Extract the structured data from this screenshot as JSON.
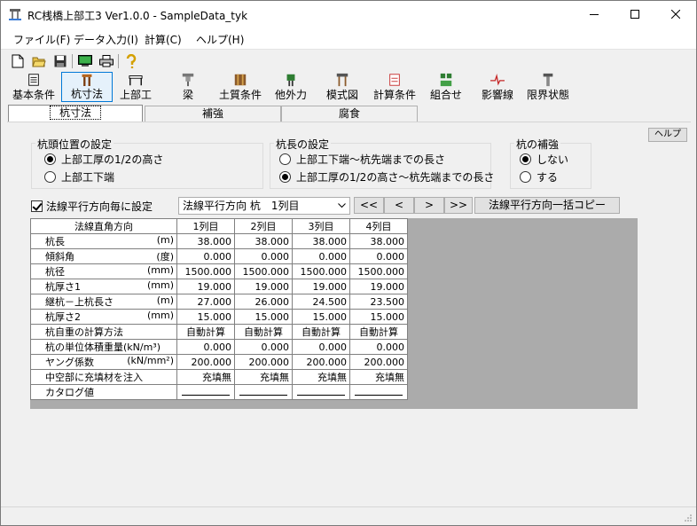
{
  "window": {
    "title": "RC桟橋上部工3 Ver1.0.0 - SampleData_tyk"
  },
  "menu": [
    "ファイル(F)",
    "データ入力(I)",
    "計算(C)",
    "ヘルプ(H)"
  ],
  "toolbar_small": [
    "new-file-icon",
    "open-folder-icon",
    "save-icon",
    "calc-icon",
    "print-icon",
    "help-icon"
  ],
  "toolbar_big": [
    {
      "label": "基本条件"
    },
    {
      "label": "杭寸法"
    },
    {
      "label": "上部工"
    },
    {
      "label": "梁"
    },
    {
      "label": "土質条件"
    },
    {
      "label": "他外力"
    },
    {
      "label": "模式図"
    },
    {
      "label": "計算条件"
    },
    {
      "label": "組合せ"
    },
    {
      "label": "影響線"
    },
    {
      "label": "限界状態"
    }
  ],
  "tabs": [
    {
      "label": "杭寸法"
    },
    {
      "label": "補強"
    },
    {
      "label": "腐食"
    }
  ],
  "help_button": "ヘルプ",
  "group_pile_head": {
    "title": "杭頭位置の設定",
    "options": [
      "上部工厚の1/2の高さ",
      "上部工下端"
    ],
    "selected": 0
  },
  "group_pile_length": {
    "title": "杭長の設定",
    "options": [
      "上部工下端～杭先端までの長さ",
      "上部工厚の1/2の高さ～杭先端までの長さ"
    ],
    "selected": 1
  },
  "group_reinforce": {
    "title": "杭の補強",
    "options": [
      "しない",
      "する"
    ],
    "selected": 0
  },
  "per_row_checkbox": "法線平行方向毎に設定",
  "combo_value": "法線平行方向 杭　1列目",
  "nav_buttons": [
    "<<",
    "<",
    ">",
    ">>"
  ],
  "copy_button": "法線平行方向一括コピー",
  "grid": {
    "corner": "法線直角方向",
    "columns": [
      "1列目",
      "2列目",
      "3列目",
      "4列目"
    ],
    "rows": [
      {
        "label": "杭長",
        "unit": "(m)",
        "values": [
          "38.000",
          "38.000",
          "38.000",
          "38.000"
        ]
      },
      {
        "label": "傾斜角",
        "unit": "(度)",
        "values": [
          "0.000",
          "0.000",
          "0.000",
          "0.000"
        ]
      },
      {
        "label": "杭径",
        "unit": "(mm)",
        "values": [
          "1500.000",
          "1500.000",
          "1500.000",
          "1500.000"
        ]
      },
      {
        "label": "杭厚さ1",
        "unit": "(mm)",
        "values": [
          "19.000",
          "19.000",
          "19.000",
          "19.000"
        ]
      },
      {
        "label": "継杭－上杭長さ",
        "unit": "(m)",
        "values": [
          "27.000",
          "26.000",
          "24.500",
          "23.500"
        ]
      },
      {
        "label": "杭厚さ2",
        "unit": "(mm)",
        "values": [
          "15.000",
          "15.000",
          "15.000",
          "15.000"
        ]
      },
      {
        "label": "杭自重の計算方法",
        "unit": "",
        "values": [
          "自動計算",
          "自動計算",
          "自動計算",
          "自動計算"
        ],
        "align": "center"
      },
      {
        "label": "杭の単位体積重量(kN/m³)",
        "unit": "",
        "values": [
          "0.000",
          "0.000",
          "0.000",
          "0.000"
        ]
      },
      {
        "label": "ヤング係数",
        "unit": "(kN/mm²)",
        "values": [
          "200.000",
          "200.000",
          "200.000",
          "200.000"
        ]
      },
      {
        "label": "中空部に充填材を注入",
        "unit": "",
        "values": [
          "充填無",
          "充填無",
          "充填無",
          "充填無"
        ],
        "align": "right"
      },
      {
        "label": "カタログ値",
        "unit": "",
        "values": [
          "",
          "",
          "",
          ""
        ],
        "dash": true
      }
    ]
  }
}
